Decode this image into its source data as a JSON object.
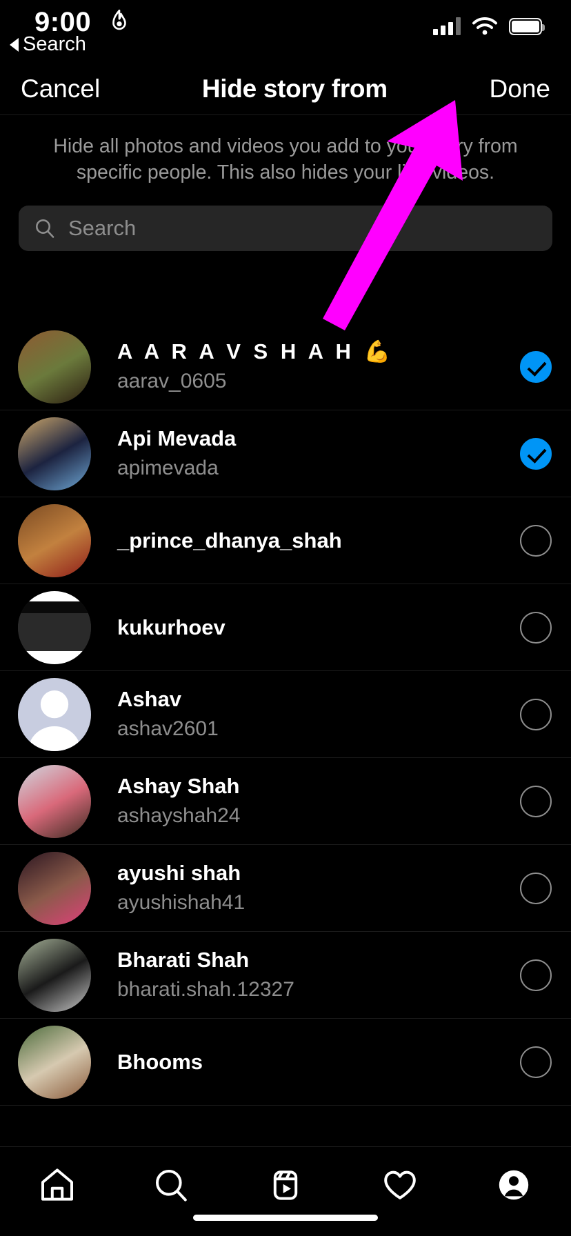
{
  "status_bar": {
    "time": "9:00",
    "flame_icon": "flame-icon",
    "signal_icon": "signal-bars-icon",
    "wifi_icon": "wifi-icon",
    "battery_icon": "battery-icon"
  },
  "back_link": {
    "label": "Search",
    "icon": "back-triangle-icon"
  },
  "navbar": {
    "cancel_label": "Cancel",
    "title": "Hide story from",
    "done_label": "Done"
  },
  "description": "Hide all photos and videos you add to your story from specific people. This also hides your live videos.",
  "search": {
    "placeholder": "Search",
    "value": "",
    "icon": "search-icon"
  },
  "colors": {
    "accent_blue": "#0095f6",
    "background": "#000000",
    "secondary_text": "#8e8e8e",
    "search_field": "#262626",
    "annotation_arrow": "#ff00ff",
    "divider": "#1b1b1b"
  },
  "users": [
    {
      "fullname": "A A R A V  S H A H",
      "spaced": true,
      "emoji": "💪",
      "username": "aarav_0605",
      "selected": true,
      "avatar_type": "photo",
      "avatar_colors": [
        "#8e5a32",
        "#6b7a3c",
        "#2b1c10"
      ]
    },
    {
      "fullname": "Api Mevada",
      "spaced": false,
      "emoji": "",
      "username": "apimevada",
      "selected": true,
      "avatar_type": "photo",
      "avatar_colors": [
        "#cfa96b",
        "#1c2340",
        "#6fa8d6"
      ]
    },
    {
      "fullname": "",
      "spaced": false,
      "emoji": "",
      "username": "_prince_dhanya_shah",
      "selected": false,
      "avatar_type": "photo",
      "avatar_colors": [
        "#7a4a22",
        "#c2813f",
        "#8e1b18"
      ]
    },
    {
      "fullname": "",
      "spaced": false,
      "emoji": "",
      "username": "kukurhoev",
      "selected": false,
      "avatar_type": "photo-bw",
      "avatar_colors": [
        "#ffffff",
        "#2a2a2a",
        "#0a0a0a"
      ]
    },
    {
      "fullname": "Ashav",
      "spaced": false,
      "emoji": "",
      "username": "ashav2601",
      "selected": false,
      "avatar_type": "placeholder",
      "avatar_colors": [
        "#c8cde0",
        "#ffffff"
      ]
    },
    {
      "fullname": "Ashay Shah",
      "spaced": false,
      "emoji": "",
      "username": "ashayshah24",
      "selected": false,
      "avatar_type": "photo",
      "avatar_colors": [
        "#cfd8e0",
        "#d9697a",
        "#3a2a20"
      ]
    },
    {
      "fullname": "ayushi shah",
      "spaced": false,
      "emoji": "",
      "username": "ayushishah41",
      "selected": false,
      "avatar_type": "photo",
      "avatar_colors": [
        "#2a1520",
        "#8a5a4a",
        "#e0407a"
      ]
    },
    {
      "fullname": "Bharati Shah",
      "spaced": false,
      "emoji": "",
      "username": "bharati.shah.12327",
      "selected": false,
      "avatar_type": "photo",
      "avatar_colors": [
        "#a8b49a",
        "#1a1a1a",
        "#c9c9c9"
      ]
    },
    {
      "fullname": "Bhooms",
      "spaced": false,
      "emoji": "",
      "username": "",
      "selected": false,
      "avatar_type": "photo",
      "avatar_colors": [
        "#4a6a3a",
        "#d6c9b0",
        "#8a5a3a"
      ]
    }
  ],
  "tabbar": {
    "items": [
      {
        "name": "home-icon",
        "label": "Home"
      },
      {
        "name": "search-icon",
        "label": "Search"
      },
      {
        "name": "reels-icon",
        "label": "Reels"
      },
      {
        "name": "heart-icon",
        "label": "Activity"
      },
      {
        "name": "profile-avatar-icon",
        "label": "Profile"
      }
    ]
  },
  "annotation": {
    "type": "arrow",
    "color": "#ff00ff",
    "points_to": "done-button"
  }
}
